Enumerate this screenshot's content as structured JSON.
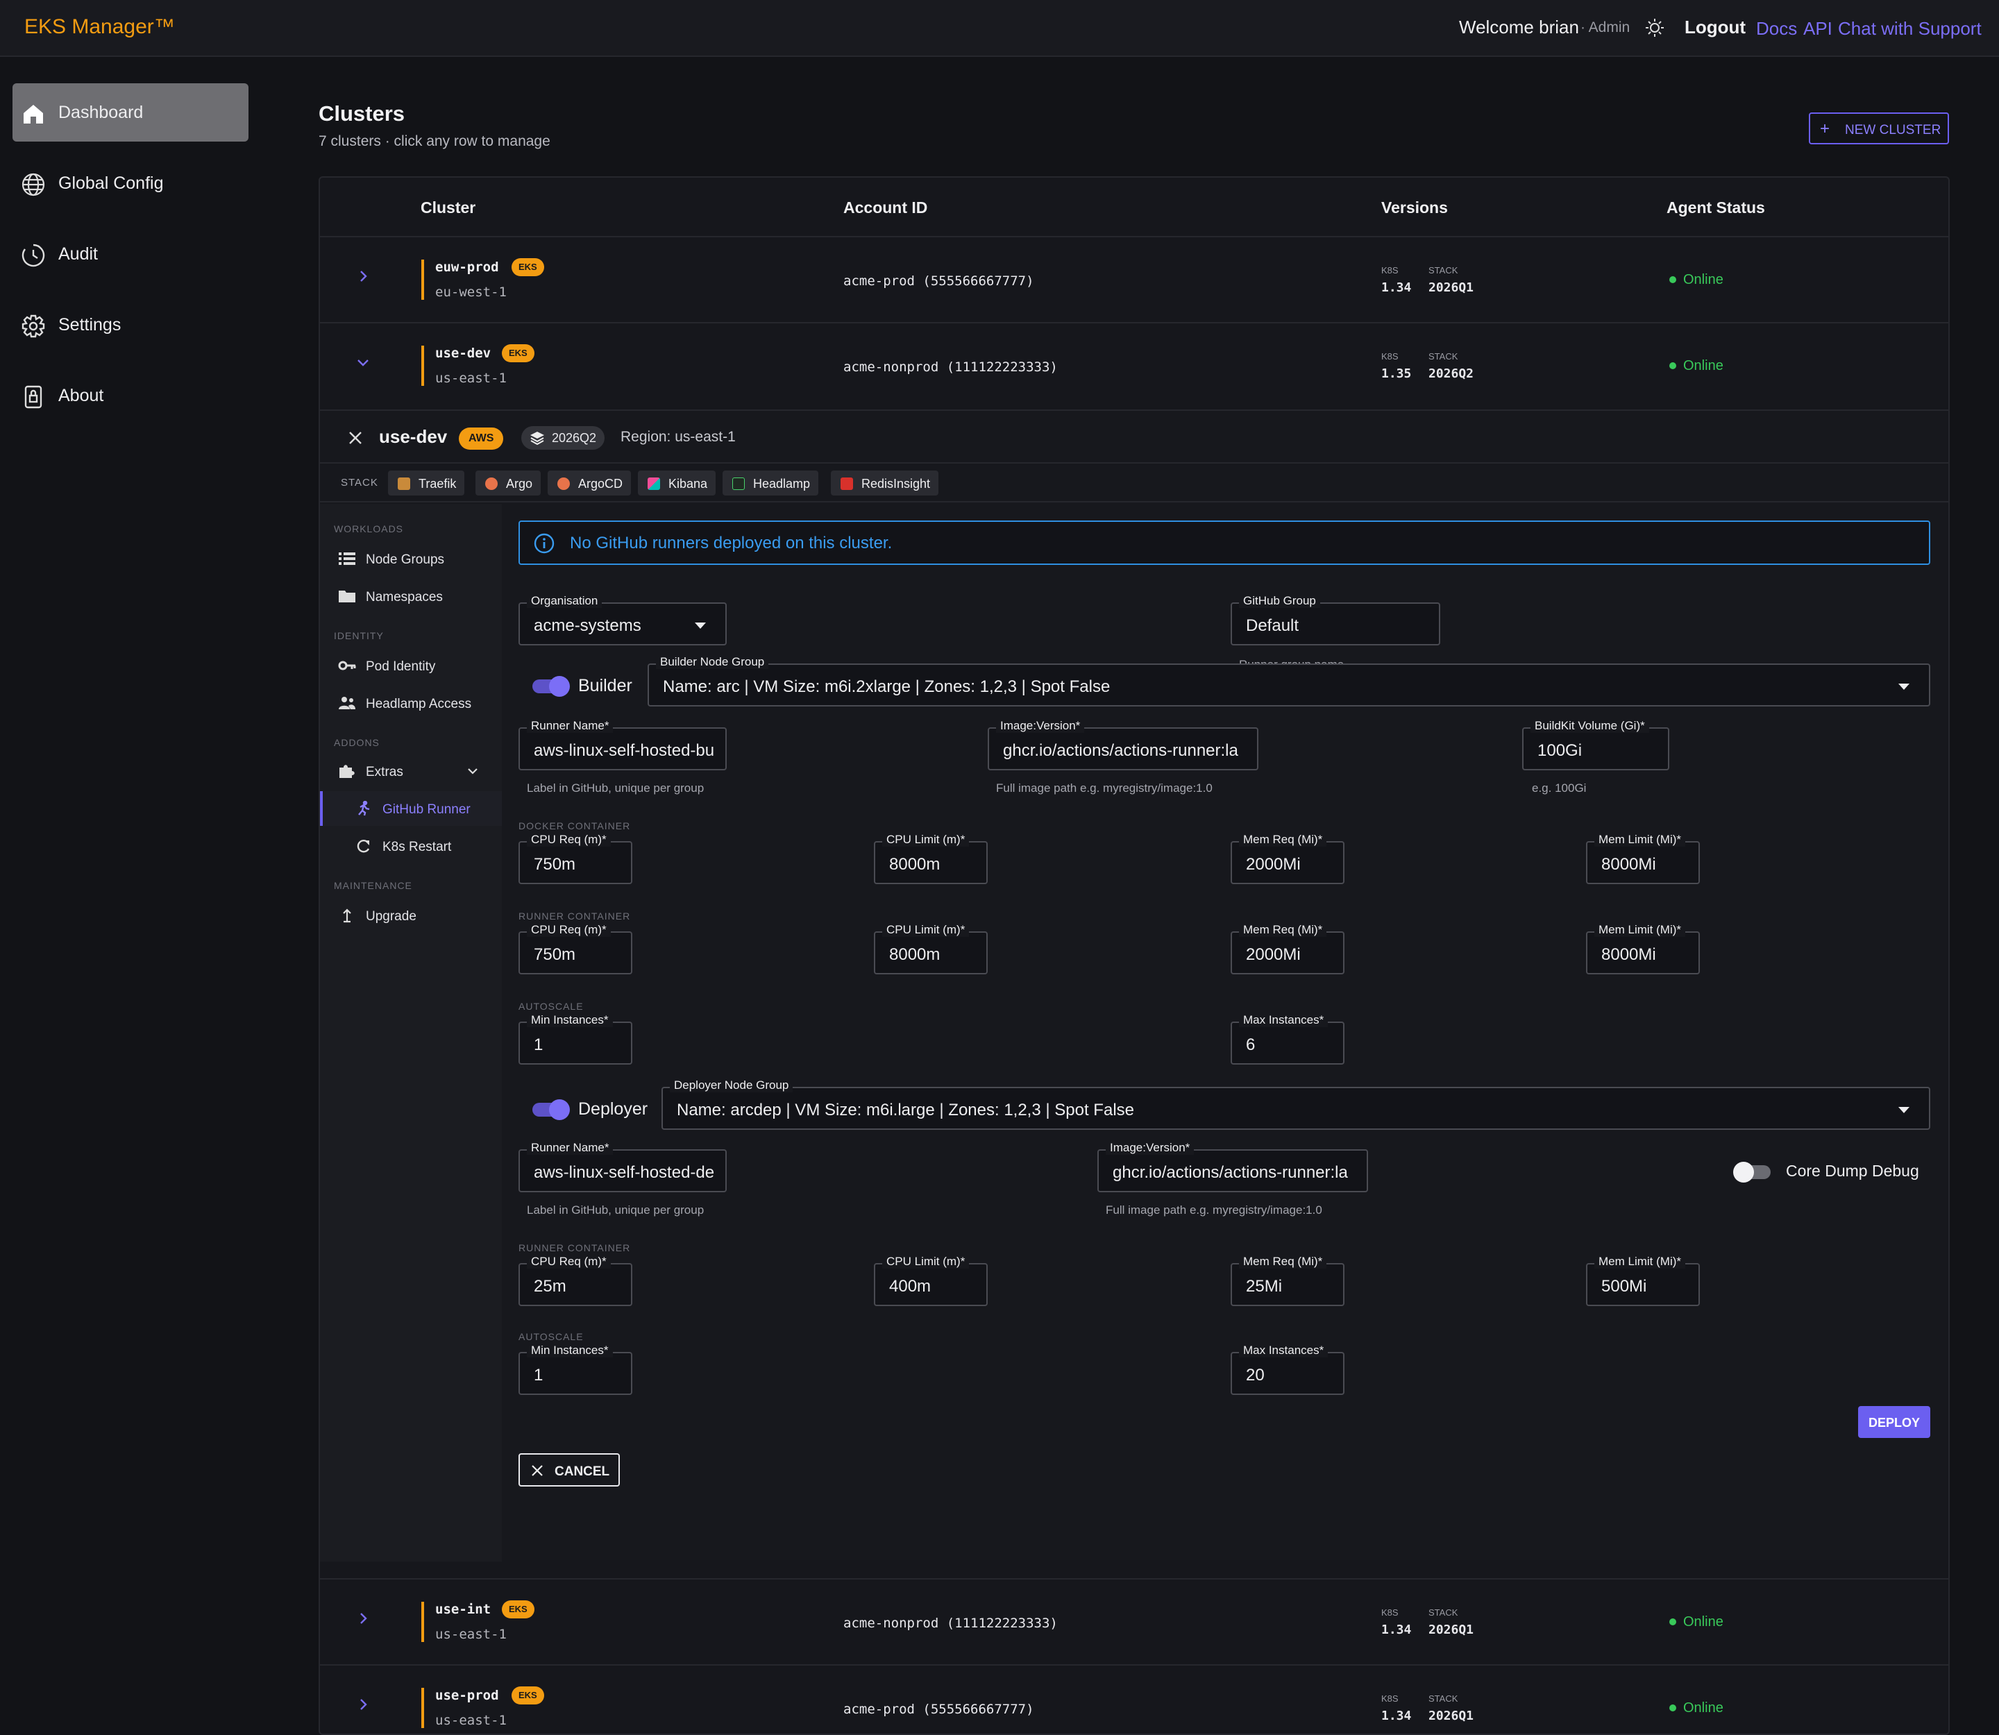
{
  "header": {
    "logo": "EKS Manager™",
    "welcome": "Welcome brian",
    "role": "· Admin",
    "logout": "Logout",
    "links": [
      "Docs",
      "API",
      "Chat with Support"
    ]
  },
  "sidebar": {
    "items": [
      {
        "label": "Dashboard",
        "icon": "home-icon",
        "active": true
      },
      {
        "label": "Global Config",
        "icon": "globe-icon"
      },
      {
        "label": "Audit",
        "icon": "clock-icon"
      },
      {
        "label": "Settings",
        "icon": "gear-icon"
      },
      {
        "label": "About",
        "icon": "lock-icon"
      }
    ]
  },
  "page": {
    "title": "Clusters",
    "subtitle": "7 clusters · click any row to manage",
    "new_cluster": "NEW CLUSTER"
  },
  "table": {
    "headers": [
      "Cluster",
      "Account ID",
      "Versions",
      "Agent Status"
    ],
    "version_keys": [
      "K8S",
      "STACK"
    ],
    "rows": [
      {
        "name": "euw-prod",
        "badge": "EKS",
        "region": "eu-west-1",
        "account": "acme-prod (555566667777)",
        "k8s": "1.34",
        "stack": "2026Q1",
        "status": "Online",
        "expanded": false
      },
      {
        "name": "use-dev",
        "badge": "EKS",
        "region": "us-east-1",
        "account": "acme-nonprod (111122223333)",
        "k8s": "1.35",
        "stack": "2026Q2",
        "status": "Online",
        "expanded": true
      },
      {
        "name": "use-int",
        "badge": "EKS",
        "region": "us-east-1",
        "account": "acme-nonprod (111122223333)",
        "k8s": "1.34",
        "stack": "2026Q1",
        "status": "Online",
        "expanded": false
      },
      {
        "name": "use-prod",
        "badge": "EKS",
        "region": "us-east-1",
        "account": "acme-prod (555566667777)",
        "k8s": "1.34",
        "stack": "2026Q1",
        "status": "Online",
        "expanded": false
      }
    ]
  },
  "detail": {
    "name": "use-dev",
    "cloud": "AWS",
    "stack": "2026Q2",
    "region": "Region: us-east-1",
    "stack_label": "STACK",
    "stack_chips": [
      "Traefik",
      "Argo",
      "ArgoCD",
      "Kibana",
      "Headlamp",
      "RedisInsight"
    ],
    "subnav": {
      "sections": [
        "WORKLOADS",
        "IDENTITY",
        "ADDONS",
        "MAINTENANCE"
      ],
      "items": [
        "Node Groups",
        "Namespaces",
        "Pod Identity",
        "Headlamp Access",
        "Extras",
        "GitHub Runner",
        "K8s Restart",
        "Upgrade"
      ]
    },
    "alert": "No GitHub runners deployed on this cluster.",
    "org": {
      "label": "Organisation",
      "value": "acme-systems"
    },
    "gh_group": {
      "label": "GitHub Group",
      "value": "Default",
      "help": "Runner group name"
    },
    "builder": {
      "toggle": "Builder",
      "node_group": {
        "label": "Builder Node Group",
        "value": "Name: arc | VM Size: m6i.2xlarge | Zones: 1,2,3 | Spot False"
      },
      "runner_name": {
        "label": "Runner Name*",
        "value": "aws-linux-self-hosted-bu",
        "help": "Label in GitHub, unique per group"
      },
      "image": {
        "label": "Image:Version*",
        "value": "ghcr.io/actions/actions-runner:la",
        "help": "Full image path e.g. myregistry/image:1.0"
      },
      "buildkit": {
        "label": "BuildKit Volume (Gi)*",
        "value": "100Gi",
        "help": "e.g. 100Gi"
      },
      "docker_title": "DOCKER CONTAINER",
      "docker": [
        {
          "label": "CPU Req (m)*",
          "value": "750m"
        },
        {
          "label": "CPU Limit (m)*",
          "value": "8000m"
        },
        {
          "label": "Mem Req (Mi)*",
          "value": "2000Mi"
        },
        {
          "label": "Mem Limit (Mi)*",
          "value": "8000Mi"
        }
      ],
      "runner_title": "RUNNER CONTAINER",
      "runner": [
        {
          "label": "CPU Req (m)*",
          "value": "750m"
        },
        {
          "label": "CPU Limit (m)*",
          "value": "8000m"
        },
        {
          "label": "Mem Req (Mi)*",
          "value": "2000Mi"
        },
        {
          "label": "Mem Limit (Mi)*",
          "value": "8000Mi"
        }
      ],
      "autoscale_title": "AUTOSCALE",
      "min": {
        "label": "Min Instances*",
        "value": "1"
      },
      "max": {
        "label": "Max Instances*",
        "value": "6"
      }
    },
    "deployer": {
      "toggle": "Deployer",
      "node_group": {
        "label": "Deployer Node Group",
        "value": "Name: arcdep | VM Size: m6i.large | Zones: 1,2,3 | Spot False"
      },
      "runner_name": {
        "label": "Runner Name*",
        "value": "aws-linux-self-hosted-de",
        "help": "Label in GitHub, unique per group"
      },
      "image": {
        "label": "Image:Version*",
        "value": "ghcr.io/actions/actions-runner:la",
        "help": "Full image path e.g. myregistry/image:1.0"
      },
      "core_dump": "Core Dump Debug",
      "runner_title": "RUNNER CONTAINER",
      "runner": [
        {
          "label": "CPU Req (m)*",
          "value": "25m"
        },
        {
          "label": "CPU Limit (m)*",
          "value": "400m"
        },
        {
          "label": "Mem Req (Mi)*",
          "value": "25Mi"
        },
        {
          "label": "Mem Limit (Mi)*",
          "value": "500Mi"
        }
      ],
      "autoscale_title": "AUTOSCALE",
      "min": {
        "label": "Min Instances*",
        "value": "1"
      },
      "max": {
        "label": "Max Instances*",
        "value": "20"
      }
    },
    "deploy": "DEPLOY",
    "cancel": "CANCEL"
  },
  "colors": {
    "accent": "#6b5ff0",
    "orange": "#f39c12",
    "online": "#39c95a",
    "info": "#2f8fe0"
  }
}
